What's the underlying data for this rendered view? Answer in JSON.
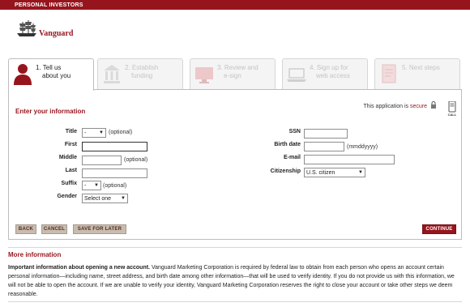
{
  "topbar": {
    "label": "PERSONAL INVESTORS"
  },
  "brand": {
    "name": "Vanguard"
  },
  "steps": [
    {
      "number": "1.",
      "line1": "Tell us",
      "line2": "about you",
      "icon": "person-icon",
      "active": true
    },
    {
      "number": "2.",
      "line1": "Establish",
      "line2": "funding",
      "icon": "bank-icon",
      "active": false
    },
    {
      "number": "3.",
      "line1": "Review and",
      "line2": "e-sign",
      "icon": "monitor-icon",
      "active": false
    },
    {
      "number": "4.",
      "line1": "Sign up for",
      "line2": "web access",
      "icon": "laptop-icon",
      "active": false
    },
    {
      "number": "5.",
      "line1": "Next steps",
      "line2": "",
      "icon": "document-icon",
      "active": false
    }
  ],
  "form": {
    "section_title": "Enter your information",
    "secure_prefix": "This application is",
    "secure_link": "secure",
    "call_label": "CALL",
    "title_label": "Title",
    "title_value": "-",
    "title_hint": "(optional)",
    "first_label": "First",
    "first_value": "",
    "middle_label": "Middle",
    "middle_value": "",
    "middle_hint": "(optional)",
    "last_label": "Last",
    "last_value": "",
    "suffix_label": "Suffix",
    "suffix_value": "-",
    "suffix_hint": "(optional)",
    "gender_label": "Gender",
    "gender_value": "Select one",
    "ssn_label": "SSN",
    "ssn_value": "",
    "birth_label": "Birth date",
    "birth_value": "",
    "birth_hint": "(mmddyyyy)",
    "email_label": "E-mail",
    "email_value": "",
    "citizenship_label": "Citizenship",
    "citizenship_value": "U.S. citizen"
  },
  "buttons": {
    "back": "BACK",
    "cancel": "CANCEL",
    "save_later": "SAVE FOR LATER",
    "continue": "CONTINUE"
  },
  "more": {
    "title": "More information",
    "bold_lead": "Important information about opening a new account.",
    "body": " Vanguard Marketing Corporation is required by federal law to obtain from each person who opens an account certain personal information—including name, street address, and birth date among other information—that will be used to verify identity. If you do not provide us with this information, we will not be able to open the account. If we are unable to verify your identity, Vanguard Marketing Corporation reserves the right to close your account or take other steps we deem reasonable."
  },
  "colors": {
    "brand": "#96151d",
    "button": "#c7bcaf",
    "inactive_step_text": "#c4c4c4"
  }
}
